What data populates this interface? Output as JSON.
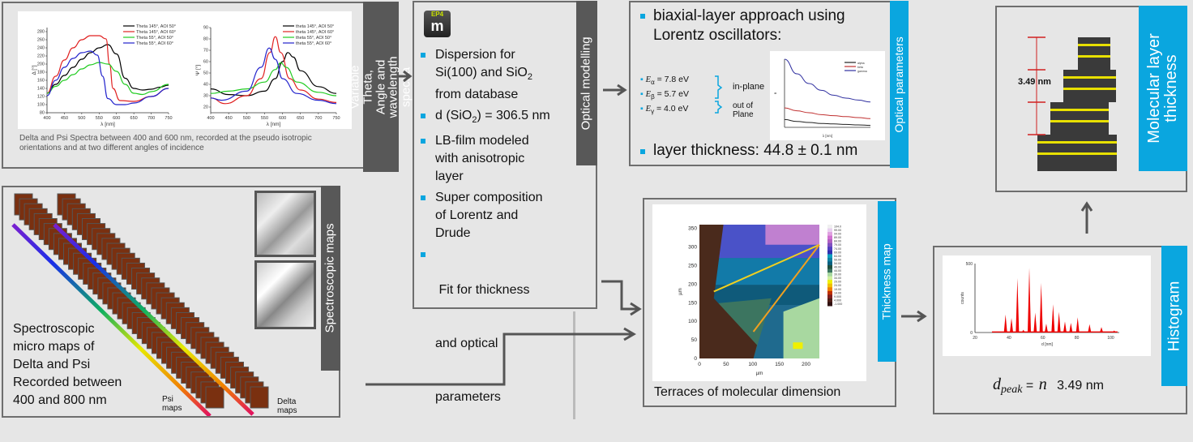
{
  "spectra": {
    "label": "Variable Theta, Angle and wavelength spectra",
    "caption": "Delta and Psi Spectra between 400 and 600 nm, recorded at the pseudo isotropic orientations and at two different angles of incidence"
  },
  "maps": {
    "label": "Spectroscopic maps",
    "description_lines": [
      "Spectroscopic",
      "micro maps of",
      "Delta and Psi",
      "Recorded between",
      "400 and 800 nm"
    ],
    "psi_label_lines": [
      "Psi",
      "maps"
    ],
    "delta_label_lines": [
      "Delta",
      "maps"
    ]
  },
  "modelling": {
    "label": "Optical modelling",
    "logo_text": "EP4",
    "logo_letter": "m",
    "bullets": [
      {
        "lines": [
          "Dispersion for",
          "Si(100) and SiO",
          "from database"
        ]
      },
      {
        "lines": [
          "d (SiO",
          ") = 306.5 nm"
        ]
      },
      {
        "lines": [
          "LB-film modeled",
          "with anisotropic",
          "layer"
        ]
      },
      {
        "lines": [
          "Super composition",
          "of Lorentz and",
          "Drude"
        ]
      },
      {
        "lines": [
          " Fit for thickness",
          "and optical",
          "parameters"
        ]
      }
    ],
    "subscript": "2"
  },
  "optical": {
    "label": "Optical parameters",
    "heading_lines": [
      "biaxial-layer approach using",
      "Lorentz oscillators:"
    ],
    "energies": [
      {
        "symbol": "E",
        "sub": "α",
        "value": "= 7.8 eV"
      },
      {
        "symbol": "E",
        "sub": "β",
        "value": "= 5.7 eV"
      },
      {
        "symbol": "E",
        "sub": "γ",
        "value": "= 4.0 eV"
      }
    ],
    "in_plane": "in-plane",
    "out_of_plane_lines": [
      "out of",
      "Plane"
    ],
    "thickness": "layer thickness: 44.8 ± 0.1 nm"
  },
  "thickness_map": {
    "label": "Thickness map",
    "caption": "Terraces of molecular dimension"
  },
  "molecular": {
    "label_lines": [
      "Molecular layer",
      "thickness"
    ],
    "dimension": "3.49 nm"
  },
  "histogram": {
    "label": "Histogram",
    "formula_var": "d",
    "formula_sub": "peak",
    "formula_eq": "=",
    "formula_n": "n",
    "formula_value": "3.49 nm"
  },
  "chart_data": [
    {
      "type": "line",
      "title": "",
      "xlabel": "λ [nm]",
      "ylabel": "Δ [°]",
      "xlim": [
        400,
        750
      ],
      "ylim": [
        80,
        290
      ],
      "xticks": [
        400,
        450,
        500,
        550,
        600,
        650,
        700,
        750
      ],
      "yticks": [
        80,
        100,
        120,
        140,
        160,
        180,
        200,
        220,
        240,
        260,
        280
      ],
      "legend_position": "top-right",
      "series": [
        {
          "name": "Theta 145°, AOI 50°",
          "color": "#000000",
          "x": [
            400,
            425,
            450,
            475,
            500,
            525,
            550,
            575,
            600,
            625,
            650,
            675,
            700,
            725,
            750
          ],
          "y": [
            128,
            150,
            172,
            192,
            212,
            228,
            240,
            248,
            225,
            165,
            140,
            136,
            138,
            143,
            148
          ]
        },
        {
          "name": "Theta 145°, AOI 60°",
          "color": "#e02020",
          "x": [
            400,
            425,
            450,
            475,
            500,
            525,
            550,
            570,
            580,
            590,
            610,
            650,
            700,
            750
          ],
          "y": [
            128,
            170,
            210,
            240,
            260,
            270,
            270,
            262,
            200,
            140,
            110,
            108,
            120,
            140
          ]
        },
        {
          "name": "Theta   55°, AOI 50°",
          "color": "#22cc22",
          "x": [
            400,
            425,
            450,
            475,
            500,
            525,
            550,
            575,
            600,
            625,
            650,
            675,
            700,
            750
          ],
          "y": [
            128,
            145,
            160,
            174,
            188,
            198,
            204,
            200,
            182,
            150,
            128,
            125,
            132,
            150
          ]
        },
        {
          "name": "Theta   55°, AOI 60°",
          "color": "#2222cc",
          "x": [
            400,
            425,
            450,
            475,
            500,
            525,
            545,
            560,
            575,
            600,
            625,
            650,
            700,
            750
          ],
          "y": [
            122,
            160,
            192,
            214,
            228,
            232,
            222,
            170,
            115,
            100,
            100,
            104,
            120,
            140
          ]
        }
      ]
    },
    {
      "type": "line",
      "title": "",
      "xlabel": "λ [nm]",
      "ylabel": "Ψ [°]",
      "xlim": [
        400,
        750
      ],
      "ylim": [
        15,
        90
      ],
      "xticks": [
        400,
        450,
        500,
        550,
        600,
        650,
        700,
        750
      ],
      "yticks": [
        20,
        30,
        40,
        50,
        60,
        70,
        80,
        90
      ],
      "legend_position": "top-right",
      "series": [
        {
          "name": "theta 145°, AOI 50°",
          "color": "#000000",
          "x": [
            400,
            450,
            500,
            550,
            580,
            600,
            615,
            630,
            650,
            700,
            750
          ],
          "y": [
            36,
            31,
            30,
            34,
            45,
            60,
            68,
            64,
            52,
            38,
            32
          ]
        },
        {
          "name": "theta 145°, AOI 60°",
          "color": "#e02020",
          "x": [
            400,
            440,
            500,
            540,
            565,
            580,
            595,
            620,
            650,
            700,
            750
          ],
          "y": [
            28,
            23,
            30,
            45,
            68,
            82,
            68,
            45,
            35,
            27,
            24
          ]
        },
        {
          "name": "theta   55°, AOI 50°",
          "color": "#22cc22",
          "x": [
            400,
            450,
            500,
            550,
            580,
            595,
            610,
            640,
            700,
            750
          ],
          "y": [
            32,
            34,
            36,
            42,
            53,
            59,
            55,
            42,
            33,
            30
          ]
        },
        {
          "name": "theta   55°, AOI 60°",
          "color": "#2222cc",
          "x": [
            400,
            430,
            500,
            540,
            563,
            580,
            600,
            640,
            700,
            750
          ],
          "y": [
            28,
            26,
            34,
            55,
            72,
            62,
            45,
            32,
            26,
            23
          ]
        }
      ]
    },
    {
      "type": "line",
      "title": "",
      "xlabel": "λ [nm]",
      "ylabel": "n",
      "xlim": [
        400,
        750
      ],
      "ylim": [
        1.6,
        2.3
      ],
      "legend_position": "top-right",
      "series": [
        {
          "name": "alpha",
          "color": "#222222",
          "x": [
            400,
            450,
            500,
            550,
            600,
            650,
            700,
            750
          ],
          "y": [
            1.68,
            1.66,
            1.65,
            1.64,
            1.635,
            1.63,
            1.625,
            1.62
          ]
        },
        {
          "name": "beta",
          "color": "#c03030",
          "x": [
            400,
            450,
            500,
            550,
            600,
            650,
            700,
            750
          ],
          "y": [
            1.8,
            1.77,
            1.75,
            1.73,
            1.72,
            1.71,
            1.7,
            1.69
          ]
        },
        {
          "name": "gamma",
          "color": "#3030a0",
          "x": [
            400,
            450,
            500,
            550,
            600,
            650,
            700,
            750
          ],
          "y": [
            2.3,
            2.15,
            2.05,
            1.98,
            1.93,
            1.9,
            1.88,
            1.86
          ]
        }
      ]
    },
    {
      "type": "bar",
      "title": "",
      "xlabel": "d [nm]",
      "ylabel": "counts",
      "xlim": [
        20,
        105
      ],
      "ylim": [
        0,
        500
      ],
      "xticks": [
        20,
        40,
        60,
        80,
        100
      ],
      "yticks": [
        0,
        500
      ],
      "peaks": [
        {
          "x": 38,
          "y": 130
        },
        {
          "x": 41.5,
          "y": 105
        },
        {
          "x": 45,
          "y": 395
        },
        {
          "x": 48.5,
          "y": 20
        },
        {
          "x": 52,
          "y": 470
        },
        {
          "x": 55.5,
          "y": 145
        },
        {
          "x": 59,
          "y": 360
        },
        {
          "x": 62,
          "y": 65
        },
        {
          "x": 66,
          "y": 205
        },
        {
          "x": 69.5,
          "y": 150
        },
        {
          "x": 73,
          "y": 80
        },
        {
          "x": 76.5,
          "y": 70
        },
        {
          "x": 80.5,
          "y": 110
        },
        {
          "x": 87.5,
          "y": 60
        },
        {
          "x": 94.5,
          "y": 40
        },
        {
          "x": 102,
          "y": 15
        }
      ]
    },
    {
      "type": "heatmap",
      "title": "",
      "xlabel": "µm",
      "ylabel": "µm",
      "xlim": [
        0,
        225
      ],
      "ylim": [
        0,
        360
      ],
      "xticks": [
        0,
        50,
        100,
        150,
        200
      ],
      "yticks": [
        0,
        50,
        100,
        150,
        200,
        250,
        300,
        350
      ],
      "colorbar_labels": [
        "104.0",
        "99.00",
        "94.00",
        "89.00",
        "84.00",
        "79.00",
        "74.00",
        "69.00",
        "64.00",
        "59.00",
        "54.00",
        "49.00",
        "44.00",
        "39.00",
        "34.00",
        "29.00",
        "24.00",
        "19.00",
        "14.00",
        "9.000",
        "4.000",
        "-1.000"
      ]
    }
  ]
}
